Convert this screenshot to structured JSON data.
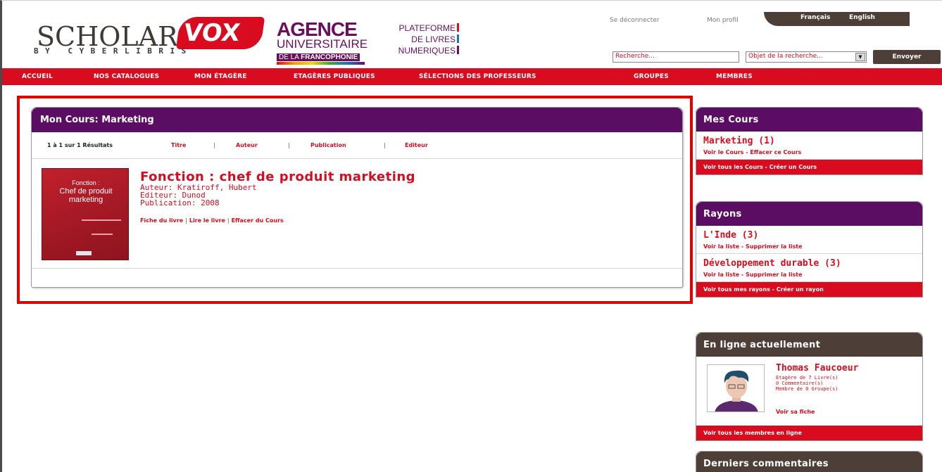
{
  "header": {
    "logo_main": "SCHOLAR",
    "logo_vox": "VOX",
    "logo_sub": "BY CYBERLIBRIS",
    "agence_line1": "AGENCE",
    "agence_line2": "UNIVERSITAIRE",
    "agence_line3_prefix": "DE LA",
    "agence_line3_bold": "FRANCOPHONIE",
    "plateforme": [
      "PLATEFORME",
      "DE LIVRES",
      "NUMERIQUES"
    ],
    "plateforme_bar_colors": [
      "#d80c1e",
      "#1d71b8",
      "#6a0e5e"
    ],
    "logout": "Se déconnecter",
    "profile": "Mon profil",
    "lang_fr": "Français",
    "lang_en": "English",
    "search_placeholder": "Recherche...",
    "search_select": "Objet de la recherche...",
    "search_button": "Envoyer"
  },
  "nav": {
    "items": [
      "Accueil",
      "Nos catalogues",
      "Mon étagère",
      "Etagères publiques",
      "Sélections des professeurs",
      "Groupes",
      "Membres"
    ]
  },
  "course": {
    "title": "Mon Cours: Marketing",
    "results": "1 à 1 sur 1 Résultats",
    "sort_titre": "Titre",
    "sort_auteur": "Auteur",
    "sort_publication": "Publication",
    "sort_editeur": "Editeur",
    "book": {
      "title": "Fonction : chef de produit marketing",
      "author": "Auteur: Kratiroff, Hubert",
      "publisher": "Editeur: Dunod",
      "publication": "Publication: 2008",
      "action_fiche": "Fiche du livre",
      "action_lire": "Lire le livre",
      "action_effacer": "Effacer du Cours",
      "cover_line1": "Fonction :",
      "cover_line2": "Chef de produit",
      "cover_line3": "marketing"
    }
  },
  "sidebar": {
    "mes_cours": {
      "title": "Mes Cours",
      "entry_title": "Marketing (1)",
      "entry_links": "Voir le Cours - Effacer ce Cours",
      "footer": "Voir tous les Cours - Créer un Cours"
    },
    "rayons": {
      "title": "Rayons",
      "entries": [
        {
          "title": "L'Inde (3)",
          "links": "Voir la liste - Supprimer la liste"
        },
        {
          "title": "Développement durable (3)",
          "links": "Voir la liste - Supprimer la liste"
        }
      ],
      "footer": "Voir tous mes rayons - Créer un rayon"
    },
    "en_ligne": {
      "title": "En ligne actuellement",
      "user_name": "Thomas Faucoeur",
      "user_stats": [
        "Etagère de 7 Livre(s)",
        "0 Commentaire(s)",
        "Membre de 0 Groupe(s)"
      ],
      "user_link": "Voir sa fiche",
      "footer": "Voir tous les membres en ligne"
    },
    "derniers": {
      "title": "Derniers commentaires"
    }
  },
  "colors": {
    "brand_red": "#d80c1e",
    "purple": "#5b0d63",
    "brown": "#4d3e37"
  }
}
